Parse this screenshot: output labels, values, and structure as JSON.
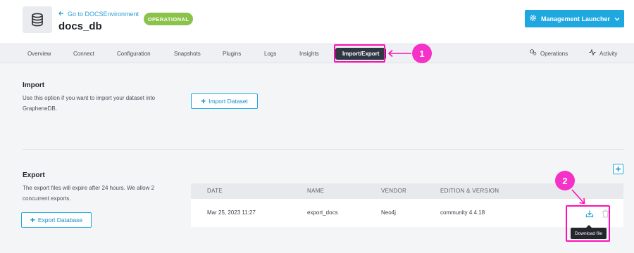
{
  "header": {
    "back_link": "Go to DOCSEnvironment",
    "db_name": "docs_db",
    "status": "OPERATIONAL",
    "launcher_label": "Management Launcher"
  },
  "tabs": [
    {
      "label": "Overview"
    },
    {
      "label": "Connect"
    },
    {
      "label": "Configuration"
    },
    {
      "label": "Snapshots"
    },
    {
      "label": "Plugins"
    },
    {
      "label": "Logs"
    },
    {
      "label": "Insights"
    },
    {
      "label": "Import/Export",
      "active": true
    }
  ],
  "right_tabs": [
    {
      "label": "Operations",
      "icon": "gears-icon"
    },
    {
      "label": "Activity",
      "icon": "activity-icon"
    }
  ],
  "import": {
    "title": "Import",
    "description": "Use this option if you want to import your dataset into GrapheneDB.",
    "button_label": "Import Dataset"
  },
  "export": {
    "title": "Export",
    "description": "The export files will expire after 24 hours. We allow 2 concurrent exports.",
    "button_label": "Export Database",
    "table": {
      "columns": [
        "DATE",
        "NAME",
        "VENDOR",
        "EDITION & VERSION"
      ],
      "rows": [
        {
          "date": "Mar 25, 2023 11:27",
          "name": "export_docs",
          "vendor": "Neo4j",
          "edition": "community 4.4.18"
        }
      ]
    },
    "tooltip": "Download file"
  },
  "callouts": [
    "1",
    "2"
  ],
  "colors": {
    "accent": "#1fa7e0",
    "status_green": "#8bc34a",
    "highlight": "#ff0fb5",
    "callout": "#f531c7",
    "active_tab": "#2f3742"
  }
}
